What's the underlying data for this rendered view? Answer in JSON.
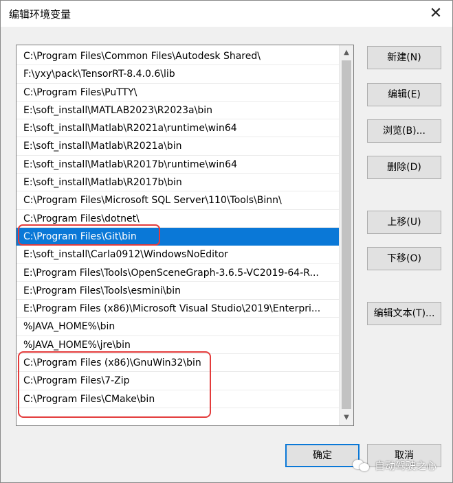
{
  "window": {
    "title": "编辑环境变量",
    "close_glyph": "✕"
  },
  "list": {
    "items": [
      "C:\\Program Files\\Common Files\\Autodesk Shared\\",
      "F:\\yxy\\pack\\TensorRT-8.4.0.6\\lib",
      "C:\\Program Files\\PuTTY\\",
      "E:\\soft_install\\MATLAB2023\\R2023a\\bin",
      "E:\\soft_install\\Matlab\\R2021a\\runtime\\win64",
      "E:\\soft_install\\Matlab\\R2021a\\bin",
      "E:\\soft_install\\Matlab\\R2017b\\runtime\\win64",
      "E:\\soft_install\\Matlab\\R2017b\\bin",
      "C:\\Program Files\\Microsoft SQL Server\\110\\Tools\\Binn\\",
      "C:\\Program Files\\dotnet\\",
      "C:\\Program Files\\Git\\bin",
      "E:\\soft_install\\Carla0912\\WindowsNoEditor",
      "E:\\Program Files\\Tools\\OpenSceneGraph-3.6.5-VC2019-64-R...",
      "E:\\Program Files\\Tools\\esmini\\bin",
      "E:\\Program Files (x86)\\Microsoft Visual Studio\\2019\\Enterpri...",
      "%JAVA_HOME%\\bin",
      "%JAVA_HOME%\\jre\\bin",
      "C:\\Program Files (x86)\\GnuWin32\\bin",
      "C:\\Program Files\\7-Zip",
      "C:\\Program Files\\CMake\\bin",
      ""
    ],
    "selected_index": 10,
    "scroll_up_glyph": "▲",
    "scroll_down_glyph": "▼"
  },
  "buttons": {
    "new": "新建(N)",
    "edit": "编辑(E)",
    "browse": "浏览(B)...",
    "delete": "删除(D)",
    "move_up": "上移(U)",
    "move_down": "下移(O)",
    "edit_text": "编辑文本(T)...",
    "ok": "确定",
    "cancel": "取消"
  },
  "watermark": {
    "text": "自动驾驶之心",
    "icon": "wechat-icon"
  },
  "colors": {
    "selection": "#0a78d7",
    "highlight_outline": "#e33b3b"
  }
}
